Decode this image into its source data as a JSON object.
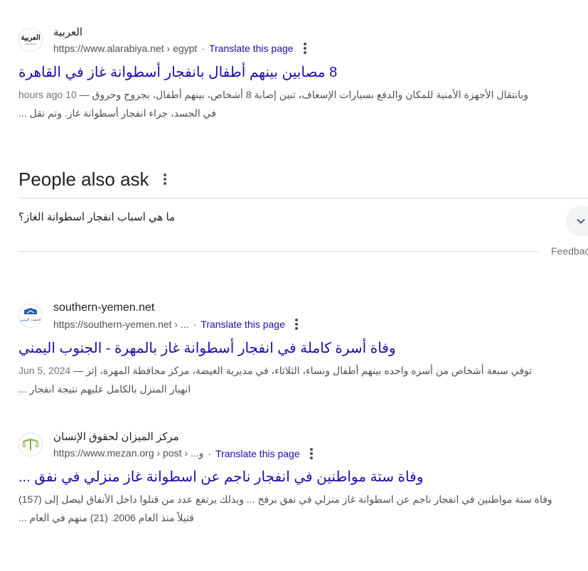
{
  "results": [
    {
      "site_name": "العربية",
      "url": "https://www.alarabiya.net › egypt",
      "translate": "Translate this page",
      "title": "8 مصابين بينهم أطفال بانفجار أسطوانة غاز في القاهرة",
      "date": "10 hours ago",
      "snippet_line1": "وبانتقال الأجهزة الأمنية للمكان والدفع بسيارات الإسعاف، تبين إصابة 8 أشخاص، بينهم أطفال، بجروح وحروق",
      "snippet_line2": "في الجسد، جراء انفجار أسطوانة غاز. وتم نقل ...",
      "favicon_text": "العربية",
      "favicon_sub": "alarabiya"
    },
    {
      "site_name": "southern-yemen.net",
      "url": "https://southern-yemen.net › ...",
      "translate": "Translate this page",
      "title": "وفاة أسرة كاملة في انفجار أسطوانة غاز بالمهرة - الجنوب اليمني",
      "date": "Jun 5, 2024",
      "snippet_line1": "توفي سبعة أشخاص من أسره واحده بينهم أطفال ونساء، الثلاثاء، في مديرية الغيضة، مركز محافظة المهرة، إثر",
      "snippet_line2": "انهيار المنزل بالكامل عليهم نتيجة انفجار ...",
      "favicon_text": "الجنوب اليمني"
    },
    {
      "site_name": "مركز الميزان لحقوق الإنسان",
      "url": "https://www.mezan.org › post › ...و",
      "translate": "Translate this page",
      "title": "وفاة ستة مواطنين في انفجار ناجم عن اسطوانة غاز منزلي في نفق ...",
      "snippet_line1": "وفاة ستة مواطنين في انفجار ناجم عن اسطوانة غاز منزلي في نفق برفح ... وبذلك يرتفع عدد من قتلوا داخل الأنفاق ليصل إلى (157)",
      "snippet_line2": "قتيلاً منذ العام 2006. (21) منهم في العام ..."
    }
  ],
  "paa": {
    "heading": "People also ask",
    "question": "ما هي اسباب انفجار اسطوانة الغاز؟",
    "feedback": "Feedback"
  },
  "colors": {
    "link": "#1a0dab",
    "text": "#202124",
    "muted": "#4d5156"
  }
}
